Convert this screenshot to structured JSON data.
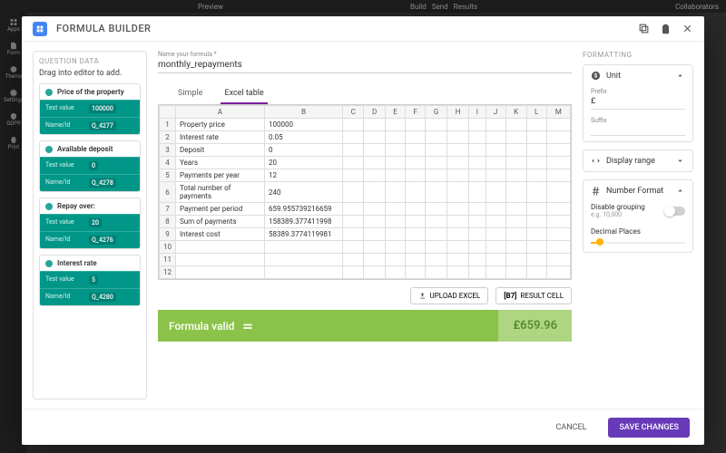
{
  "bg": {
    "top_tabs": [
      "Preview",
      "Build",
      "Send",
      "Results"
    ],
    "collab": "Collaborators",
    "side": [
      "Apps",
      "Form",
      "Theme",
      "Settings",
      "GDPR",
      "Print"
    ]
  },
  "header": {
    "title": "FORMULA BUILDER"
  },
  "left": {
    "fieldset": "QUESTION DATA",
    "hint": "Drag into editor to add.",
    "testvalue_label": "Test value",
    "nameid_label": "Name/Id",
    "questions": [
      {
        "label": "Price of the property",
        "testvalue": "100000",
        "nameid": "Q_4277"
      },
      {
        "label": "Available deposit",
        "testvalue": "0",
        "nameid": "Q_4278"
      },
      {
        "label": "Repay over:",
        "testvalue": "20",
        "nameid": "Q_4276"
      },
      {
        "label": "Interest rate",
        "testvalue": "5",
        "nameid": "Q_4280"
      }
    ]
  },
  "center": {
    "name_label": "Name your formula *",
    "name_value": "monthly_repayments",
    "tabs": {
      "simple": "Simple",
      "excel": "Excel table"
    },
    "cols": [
      "",
      "A",
      "B",
      "C",
      "D",
      "E",
      "F",
      "G",
      "H",
      "I",
      "J",
      "K",
      "L",
      "M"
    ],
    "rows": [
      {
        "n": "1",
        "a": "Property price",
        "b": "100000"
      },
      {
        "n": "2",
        "a": "Interest rate",
        "b": "0.05"
      },
      {
        "n": "3",
        "a": "Deposit",
        "b": "0"
      },
      {
        "n": "4",
        "a": "Years",
        "b": "20"
      },
      {
        "n": "5",
        "a": "Payments per year",
        "b": "12"
      },
      {
        "n": "6",
        "a": "Total number of payments",
        "b": "240"
      },
      {
        "n": "7",
        "a": "Payment per period",
        "b": "659.955739216659"
      },
      {
        "n": "8",
        "a": "Sum of payments",
        "b": "158389.377411998"
      },
      {
        "n": "9",
        "a": "Interest cost",
        "b": "58389.3774119981"
      },
      {
        "n": "10",
        "a": "",
        "b": ""
      },
      {
        "n": "11",
        "a": "",
        "b": ""
      },
      {
        "n": "12",
        "a": "",
        "b": ""
      }
    ],
    "upload": "UPLOAD EXCEL",
    "result_cell_ref": "[B7]",
    "result_cell_label": "RESULT CELL",
    "valid": "Formula valid",
    "result_value": "£659.96"
  },
  "right": {
    "title": "FORMATTING",
    "unit": {
      "label": "Unit",
      "prefix_label": "Prefix",
      "prefix_value": "£",
      "suffix_label": "Suffix",
      "suffix_value": ""
    },
    "range": {
      "label": "Display range"
    },
    "numfmt": {
      "label": "Number Format",
      "disable_grouping": "Disable grouping",
      "grouping_hint": "e.g. 10,000",
      "decimal_label": "Decimal Places"
    }
  },
  "footer": {
    "cancel": "CANCEL",
    "save": "SAVE CHANGES"
  }
}
